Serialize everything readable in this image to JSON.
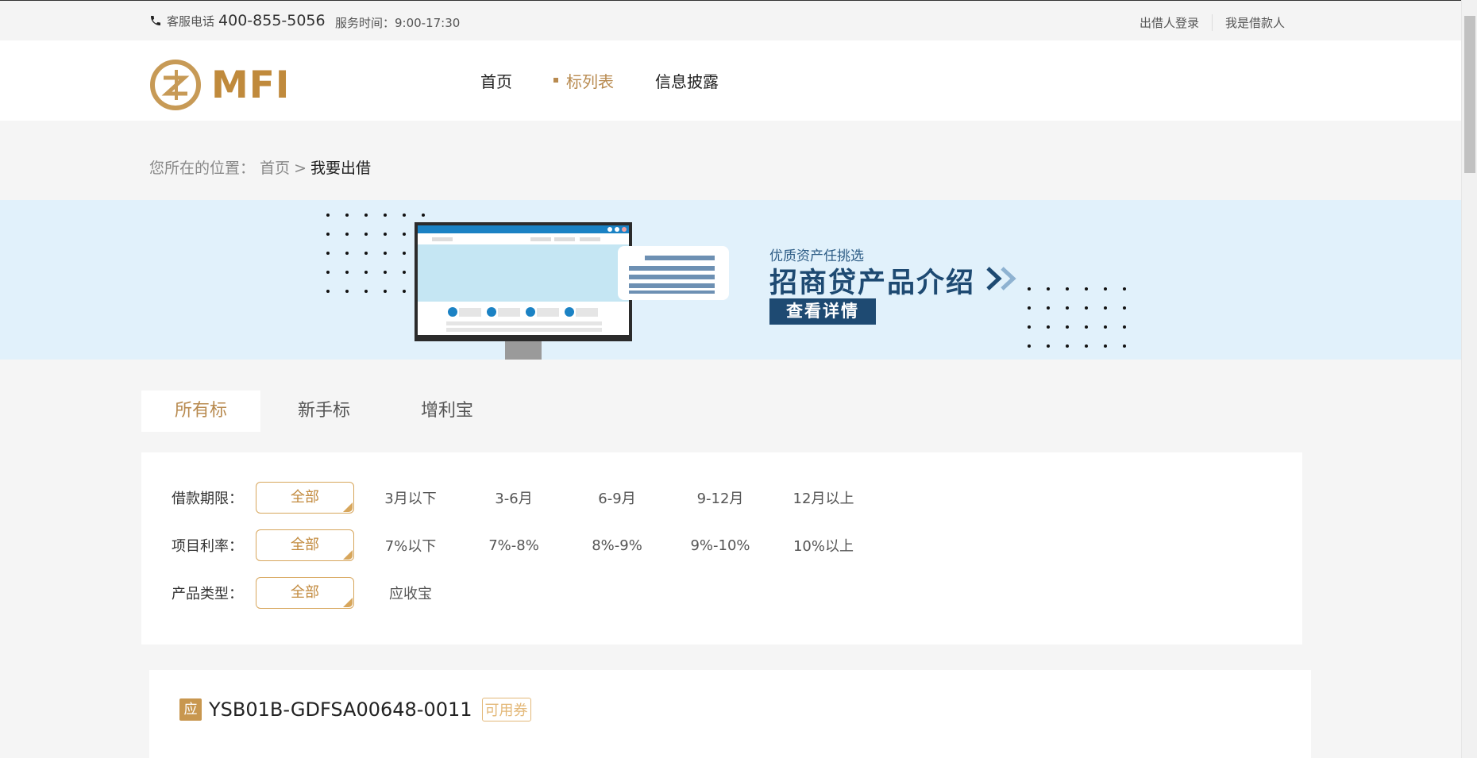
{
  "topbar": {
    "phone_label": "客服电话",
    "phone_number": "400-855-5056",
    "hours": "服务时间：9:00-17:30",
    "lender_login": "出借人登录",
    "borrower": "我是借款人"
  },
  "header": {
    "logo_text": "MFI",
    "nav": [
      {
        "label": "首页"
      },
      {
        "label": "标列表"
      },
      {
        "label": "信息披露"
      }
    ]
  },
  "breadcrumb": {
    "prefix": "您所在的位置：",
    "home": "首页",
    "sep": ">",
    "current": "我要出借"
  },
  "banner": {
    "subtitle": "优质资产任挑选",
    "title": "招商贷产品介绍",
    "button": "查看详情"
  },
  "tabs": [
    {
      "label": "所有标"
    },
    {
      "label": "新手标"
    },
    {
      "label": "增利宝"
    }
  ],
  "filters": {
    "term": {
      "label": "借款期限：",
      "options": [
        "全部",
        "3月以下",
        "3-6月",
        "6-9月",
        "9-12月",
        "12月以上"
      ]
    },
    "rate": {
      "label": "项目利率：",
      "options": [
        "全部",
        "7%以下",
        "7%-8%",
        "8%-9%",
        "9%-10%",
        "10%以上"
      ]
    },
    "type": {
      "label": "产品类型：",
      "options": [
        "全部",
        "应收宝"
      ]
    }
  },
  "listing": {
    "badge": "应",
    "code": "YSB01B-GDFSA00648-0011",
    "coupon": "可用券"
  },
  "colors": {
    "accent": "#b88a4f",
    "banner_bg": "#e1f1fb",
    "banner_text": "#1e4a72"
  }
}
